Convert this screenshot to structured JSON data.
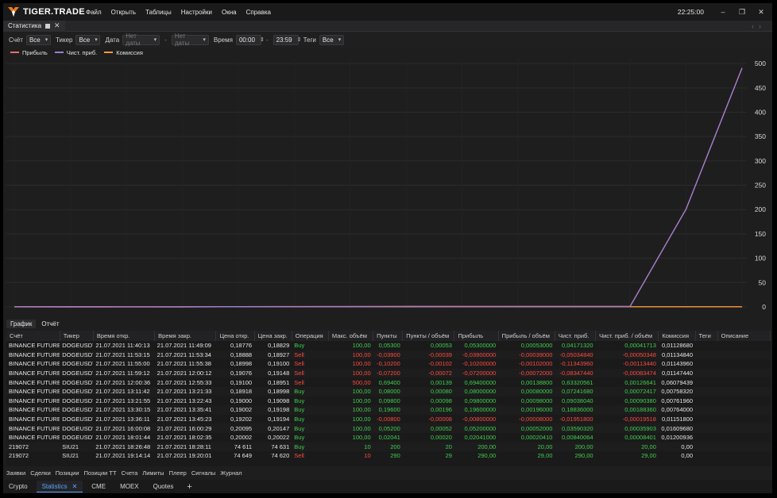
{
  "app": {
    "brand": "TIGER.TRADE",
    "menu": [
      "Файл",
      "Открыть",
      "Таблицы",
      "Настройки",
      "Окна",
      "Справка"
    ],
    "clock": "22:25:00",
    "window_controls": [
      "minimize-icon",
      "restore-icon",
      "close-icon"
    ]
  },
  "tab": {
    "label": "Статистика"
  },
  "filters": {
    "account_label": "Счёт",
    "account_value": "Все",
    "ticker_label": "Тикер",
    "ticker_value": "Все",
    "date_label": "Дата",
    "date_from": "Нет даты",
    "date_to": "Нет даты",
    "time_label": "Время",
    "time_from": "00:00",
    "time_to": "23:59",
    "tags_label": "Теги",
    "tags_value": "Все",
    "separator": "-"
  },
  "legend": [
    {
      "label": "Прибыль",
      "color": "#ff6a6a"
    },
    {
      "label": "Чист. приб.",
      "color": "#9b7fd4"
    },
    {
      "label": "Комиссия",
      "color": "#ff9a3c"
    }
  ],
  "chart_data": {
    "type": "line",
    "ylim": [
      -5,
      510
    ],
    "y_ticks": [
      0,
      50,
      100,
      150,
      200,
      250,
      300,
      350,
      400,
      450,
      500
    ],
    "x_count": 14,
    "series": [
      {
        "name": "Прибыль",
        "color": "#ff6a6a",
        "values": [
          0.053,
          0.014,
          -0.088,
          -0.16,
          0.534,
          0.614,
          0.712,
          0.908,
          0.81,
          0.862,
          0.882,
          0.882,
          200.882,
          490.882
        ]
      },
      {
        "name": "Чист. приб.",
        "color": "#9b7fd4",
        "values": [
          0.042,
          -0.008,
          -0.122,
          -0.205,
          0.428,
          0.5,
          0.578,
          0.768,
          0.72,
          0.755,
          0.764,
          0.764,
          200.764,
          490.764
        ]
      },
      {
        "name": "Комиссия",
        "color": "#ff9a3c",
        "values": [
          0.011,
          0.023,
          0.034,
          0.046,
          0.106,
          0.113,
          0.121,
          0.128,
          0.14,
          0.156,
          0.168,
          0.168,
          0.168,
          0.168
        ]
      }
    ]
  },
  "view_tabs": [
    "График",
    "Отчёт"
  ],
  "table": {
    "columns": [
      "Счёт",
      "Тикер",
      "Время откр.",
      "Время закр.",
      "Цена откр.",
      "Цена закр.",
      "Операция",
      "Макс. объём",
      "Пункты",
      "Пункты / объём",
      "Прибыль",
      "Прибыль / объём",
      "Чист. приб.",
      "Чист. приб. / объём",
      "Комиссия",
      "Теги",
      "Описание"
    ],
    "rows": [
      [
        "BINANCE FUTURES",
        "DOGEUSDT",
        "21.07.2021 11:40:13",
        "21.07.2021 11:49:09",
        "0,18776",
        "0,18829",
        "Buy",
        "100,00",
        "0,05300",
        "0,00053",
        "0,05300000",
        "0,00053000",
        "0,04171320",
        "0,00041713",
        "0,01128680",
        "",
        ""
      ],
      [
        "BINANCE FUTURES",
        "DOGEUSDT",
        "21.07.2021 11:53:15",
        "21.07.2021 11:53:34",
        "0,18888",
        "0,18927",
        "Sell",
        "100,00",
        "-0,03900",
        "-0,00039",
        "-0,03900000",
        "-0,00039000",
        "-0,05034840",
        "-0,00050348",
        "0,01134840",
        "",
        ""
      ],
      [
        "BINANCE FUTURES",
        "DOGEUSDT",
        "21.07.2021 11:55:00",
        "21.07.2021 11:55:38",
        "0,18998",
        "0,19100",
        "Sell",
        "100,00",
        "-0,10200",
        "-0,00102",
        "-0,10200000",
        "-0,00102000",
        "-0,11343960",
        "-0,00113440",
        "0,01143960",
        "",
        ""
      ],
      [
        "BINANCE FUTURES",
        "DOGEUSDT",
        "21.07.2021 11:59:12",
        "21.07.2021 12:00:12",
        "0,19076",
        "0,19148",
        "Sell",
        "100,00",
        "-0,07200",
        "-0,00072",
        "-0,07200000",
        "-0,00072000",
        "-0,08347440",
        "-0,00083474",
        "0,01147440",
        "",
        ""
      ],
      [
        "BINANCE FUTURES",
        "DOGEUSDT",
        "21.07.2021 12:00:36",
        "21.07.2021 12:55:33",
        "0,19100",
        "0,18951",
        "Sell",
        "500,00",
        "0,69400",
        "0,00139",
        "0,69400000",
        "0,00138800",
        "0,63320561",
        "0,00126641",
        "0,06079439",
        "",
        ""
      ],
      [
        "BINANCE FUTURES",
        "DOGEUSDT",
        "21.07.2021 13:11:42",
        "21.07.2021 13:21:33",
        "0,18918",
        "0,18998",
        "Buy",
        "100,00",
        "0,08000",
        "0,00080",
        "0,08000000",
        "0,00080000",
        "0,07241680",
        "0,00072417",
        "0,00758320",
        "",
        ""
      ],
      [
        "BINANCE FUTURES",
        "DOGEUSDT",
        "21.07.2021 13:21:55",
        "21.07.2021 13:22:43",
        "0,19000",
        "0,19098",
        "Buy",
        "100,00",
        "0,09800",
        "0,00098",
        "0,09800000",
        "0,00098000",
        "0,09038040",
        "0,00090380",
        "0,00761960",
        "",
        ""
      ],
      [
        "BINANCE FUTURES",
        "DOGEUSDT",
        "21.07.2021 13:30:15",
        "21.07.2021 13:35:41",
        "0,19002",
        "0,19198",
        "Buy",
        "100,00",
        "0,19600",
        "0,00196",
        "0,19600000",
        "0,00196000",
        "0,18836000",
        "0,00188360",
        "0,00764000",
        "",
        ""
      ],
      [
        "BINANCE FUTURES",
        "DOGEUSDT",
        "21.07.2021 13:36:11",
        "21.07.2021 13:45:23",
        "0,19202",
        "0,19194",
        "Buy",
        "100,00",
        "-0,00800",
        "-0,00008",
        "-0,00800000",
        "-0,00008000",
        "-0,01951800",
        "-0,00019518",
        "0,01151800",
        "",
        ""
      ],
      [
        "BINANCE FUTURES",
        "DOGEUSDT",
        "21.07.2021 16:00:08",
        "21.07.2021 16:00:29",
        "0,20095",
        "0,20147",
        "Buy",
        "100,00",
        "0,05200",
        "0,00052",
        "0,05200000",
        "0,00052000",
        "0,03590320",
        "0,00035903",
        "0,01609680",
        "",
        ""
      ],
      [
        "BINANCE FUTURES",
        "DOGEUSDT",
        "21.07.2021 18:01:44",
        "21.07.2021 18:02:35",
        "0,20002",
        "0,20022",
        "Buy",
        "100,00",
        "0,02041",
        "0,00020",
        "0,02041000",
        "0,00020410",
        "0,00840064",
        "0,00008401",
        "0,01200936",
        "",
        ""
      ],
      [
        "219072",
        "SIU21",
        "21.07.2021 18:26:48",
        "21.07.2021 18:28:11",
        "74 611",
        "74 631",
        "Buy",
        "10",
        "200",
        "20",
        "200,00",
        "20,00",
        "200,00",
        "20,00",
        "0,00",
        "",
        ""
      ],
      [
        "219072",
        "SIU21",
        "21.07.2021 19:14:14",
        "21.07.2021 19:20:01",
        "74 649",
        "74 620",
        "Sell",
        "10",
        "290",
        "29",
        "290,00",
        "29,00",
        "290,00",
        "29,00",
        "0,00",
        "",
        ""
      ]
    ]
  },
  "bottom_tabs": [
    "Заявки",
    "Сделки",
    "Позиции",
    "Позиции ТТ",
    "Счета",
    "Лимиты",
    "Плеер",
    "Сигналы",
    "Журнал"
  ],
  "workspaces": [
    {
      "label": "Crypto",
      "active": false
    },
    {
      "label": "Statistics",
      "active": true
    },
    {
      "label": "CME",
      "active": false
    },
    {
      "label": "MOEX",
      "active": false
    },
    {
      "label": "Quotes",
      "active": false
    }
  ],
  "add_workspace": "+"
}
